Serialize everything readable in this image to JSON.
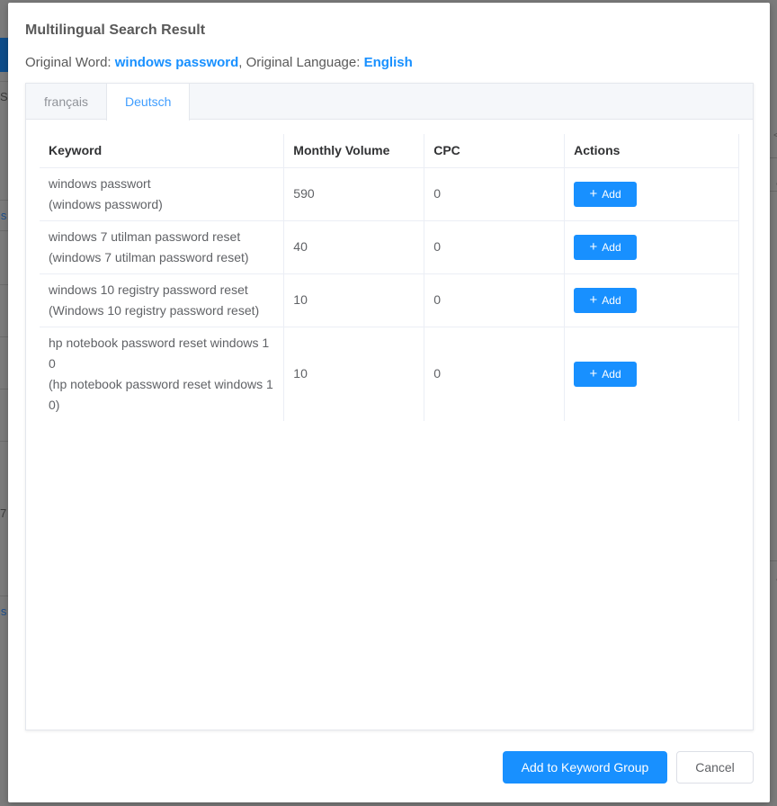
{
  "background": {
    "left_fragments": [
      "S",
      "is",
      "7",
      "is"
    ],
    "right_fragments": [
      "<",
      "/",
      "/"
    ]
  },
  "modal": {
    "title": "Multilingual Search Result",
    "original_word_label": "Original Word: ",
    "original_word": "windows password",
    "separator": ", ",
    "original_language_label": "Original Language: ",
    "original_language": "English"
  },
  "tabs": [
    {
      "label": "français",
      "active": false
    },
    {
      "label": "Deutsch",
      "active": true
    }
  ],
  "table": {
    "headers": {
      "keyword": "Keyword",
      "monthly_volume": "Monthly Volume",
      "cpc": "CPC",
      "actions": "Actions"
    },
    "rows": [
      {
        "keyword": "windows passwort",
        "translation": "(windows password)",
        "monthly_volume": "590",
        "cpc": "0",
        "action": "Add"
      },
      {
        "keyword": "windows 7 utilman password reset",
        "translation": "(windows 7 utilman password reset)",
        "monthly_volume": "40",
        "cpc": "0",
        "action": "Add"
      },
      {
        "keyword": "windows 10 registry password reset",
        "translation": "(Windows 10 registry password reset)",
        "monthly_volume": "10",
        "cpc": "0",
        "action": "Add"
      },
      {
        "keyword": "hp notebook password reset windows 10",
        "translation": "(hp notebook password reset windows 10)",
        "monthly_volume": "10",
        "cpc": "0",
        "action": "Add"
      }
    ]
  },
  "footer": {
    "primary_label": "Add to Keyword Group",
    "cancel_label": "Cancel"
  },
  "colors": {
    "accent": "#1890ff",
    "tab_active": "#409eff",
    "text": "#606266"
  }
}
